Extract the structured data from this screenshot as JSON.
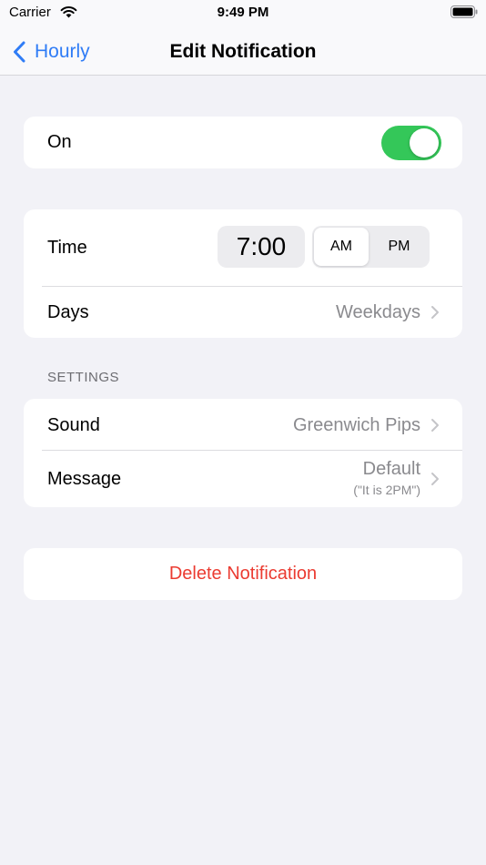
{
  "status_bar": {
    "carrier": "Carrier",
    "time": "9:49 PM"
  },
  "nav": {
    "back_label": "Hourly",
    "title": "Edit Notification"
  },
  "on_row": {
    "label": "On",
    "enabled": true
  },
  "time_row": {
    "label": "Time",
    "value": "7:00",
    "am_label": "AM",
    "pm_label": "PM",
    "selected": "AM"
  },
  "days_row": {
    "label": "Days",
    "value": "Weekdays"
  },
  "settings": {
    "header": "SETTINGS",
    "sound": {
      "label": "Sound",
      "value": "Greenwich Pips"
    },
    "message": {
      "label": "Message",
      "value": "Default",
      "subvalue": "(\"It is 2PM\")"
    }
  },
  "delete": {
    "label": "Delete Notification"
  },
  "colors": {
    "accent": "#2f7cf6",
    "toggle_on": "#34c759",
    "destructive": "#eb3b31",
    "background": "#f2f2f7"
  },
  "icons": [
    "wifi-icon",
    "battery-icon",
    "back-chevron-icon",
    "chevron-right-icon"
  ]
}
